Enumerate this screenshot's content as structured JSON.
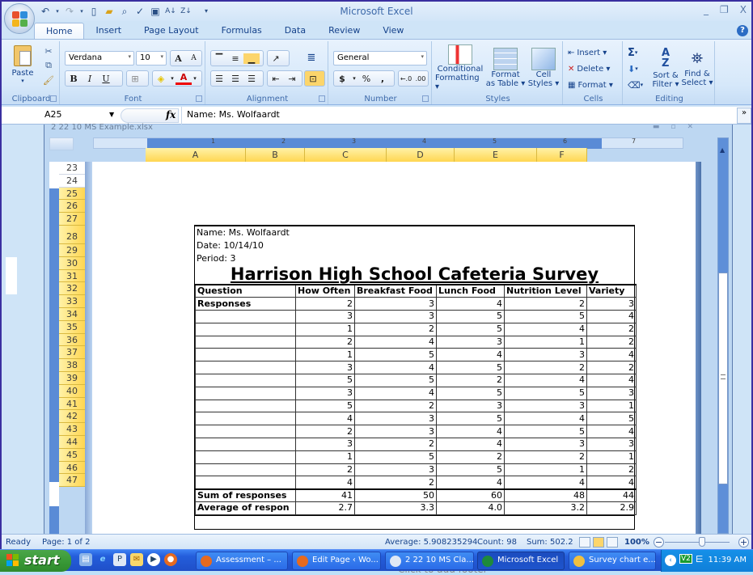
{
  "app": {
    "title": "Microsoft Excel",
    "window_controls": [
      "_",
      "❐",
      "X"
    ],
    "help": "?"
  },
  "quick_access": [
    "undo-icon",
    "redo-icon",
    "new-icon",
    "open-icon",
    "print-preview-icon",
    "spelling-icon",
    "save-icon",
    "sort-asc-icon",
    "sort-desc-icon",
    "customize-icon"
  ],
  "tabs": [
    "Home",
    "Insert",
    "Page Layout",
    "Formulas",
    "Data",
    "Review",
    "View"
  ],
  "active_tab": "Home",
  "ribbon": {
    "clipboard": {
      "label": "Clipboard",
      "paste": "Paste"
    },
    "font": {
      "label": "Font",
      "family": "Verdana",
      "size": "10",
      "bold": "B",
      "italic": "I",
      "underline": "U",
      "grow": "A",
      "shrink": "A"
    },
    "alignment": {
      "label": "Alignment"
    },
    "number": {
      "label": "Number",
      "format": "General",
      "currency": "$",
      "percent": "%",
      "comma": ",",
      "inc_decimal": "←.0 .00",
      "dec_decimal": ".00 →.0"
    },
    "styles": {
      "label": "Styles",
      "conditional": "Conditional",
      "conditional2": "Formatting",
      "format_table": "Format",
      "format_table2": "as Table",
      "cell_styles": "Cell",
      "cell_styles2": "Styles"
    },
    "cells": {
      "label": "Cells",
      "insert": "Insert",
      "delete": "Delete",
      "format": "Format"
    },
    "editing": {
      "label": "Editing",
      "sum": "Σ",
      "sort": "Sort &",
      "sort2": "Filter",
      "find": "Find &",
      "find2": "Select"
    }
  },
  "formula_bar": {
    "name_box": "A25",
    "fx": "fx",
    "content": "Name: Ms. Wolfaardt"
  },
  "workbook": {
    "title": "2 22 10 MS Example.xlsx",
    "ruler_numbers": [
      "1",
      "2",
      "3",
      "4",
      "5",
      "6",
      "7"
    ],
    "columns": [
      "A",
      "B",
      "C",
      "D",
      "E",
      "F"
    ],
    "rows": [
      "23",
      "24",
      "25",
      "26",
      "27",
      "28",
      "29",
      "30",
      "31",
      "32",
      "33",
      "34",
      "35",
      "36",
      "37",
      "38",
      "39",
      "40",
      "41",
      "42",
      "43",
      "44",
      "45",
      "46",
      "47"
    ],
    "footer_hint": "Click to add footer"
  },
  "sheet": {
    "name_line": "Name: Ms. Wolfaardt",
    "date_line": "Date: 10/14/10",
    "period_line": "Period: 3",
    "title": "Harrison High School Cafeteria Survey",
    "headers": [
      "Question",
      "How Often",
      "Breakfast Food",
      "Lunch Food",
      "Nutrition Level",
      "Variety"
    ],
    "responses_label": "Responses",
    "responses": [
      [
        2,
        3,
        4,
        2,
        3
      ],
      [
        3,
        3,
        5,
        5,
        4
      ],
      [
        1,
        2,
        5,
        4,
        2
      ],
      [
        2,
        4,
        3,
        1,
        2
      ],
      [
        1,
        5,
        4,
        3,
        4
      ],
      [
        3,
        4,
        5,
        2,
        2
      ],
      [
        5,
        5,
        2,
        4,
        4
      ],
      [
        3,
        4,
        5,
        5,
        3
      ],
      [
        5,
        2,
        3,
        3,
        1
      ],
      [
        4,
        3,
        5,
        4,
        5
      ],
      [
        2,
        3,
        4,
        5,
        4
      ],
      [
        3,
        2,
        4,
        3,
        3
      ],
      [
        1,
        5,
        2,
        2,
        1
      ],
      [
        2,
        3,
        5,
        1,
        2
      ],
      [
        4,
        2,
        4,
        4,
        4
      ]
    ],
    "sum_label": "Sum of responses",
    "sums": [
      "41",
      "50",
      "60",
      "48",
      "44"
    ],
    "avg_label": "Average of respon",
    "averages": [
      "2.7",
      "3.3",
      "4.0",
      "3.2",
      "2.9"
    ]
  },
  "status_bar": {
    "mode": "Ready",
    "page": "Page: 1 of 2",
    "average": "Average: 5.908235294",
    "count": "Count: 98",
    "sum": "Sum: 502.2",
    "zoom": "100%",
    "zoom_minus": "−",
    "zoom_plus": "+"
  },
  "taskbar": {
    "start": "start",
    "tasks": [
      {
        "label": "Assessment – ...",
        "icon": "firefox-icon"
      },
      {
        "label": "Edit Page ‹ Wo...",
        "icon": "firefox-icon"
      },
      {
        "label": "2 22 10 MS Cla...",
        "icon": "publisher-icon"
      },
      {
        "label": "Microsoft Excel",
        "icon": "excel-icon",
        "active": true
      },
      {
        "label": "Survey chart e...",
        "icon": "paint-icon"
      }
    ],
    "clock": "11:39 AM"
  }
}
